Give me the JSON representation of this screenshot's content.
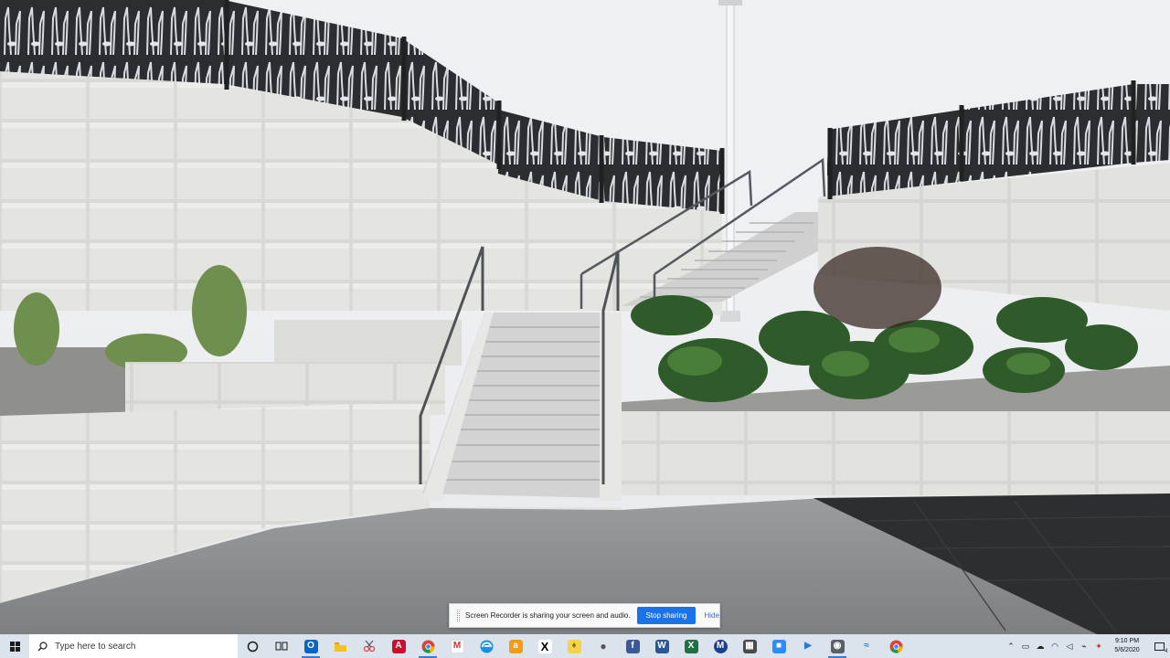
{
  "share_banner": {
    "message": "Screen Recorder is sharing your screen and audio.",
    "stop_label": "Stop sharing",
    "hide_label": "Hide"
  },
  "taskbar": {
    "search_placeholder": "Type here to search",
    "apps": [
      {
        "icon": "cortana-icon",
        "active": false
      },
      {
        "icon": "task-view-icon",
        "active": false
      },
      {
        "icon": "outlook-icon",
        "active": true
      },
      {
        "icon": "file-explorer-icon",
        "active": false
      },
      {
        "icon": "snipping-tool-icon",
        "active": false
      },
      {
        "icon": "acrobat-icon",
        "active": false
      },
      {
        "icon": "chrome-icon",
        "active": true
      },
      {
        "icon": "gmail-icon",
        "active": false
      },
      {
        "icon": "edge-icon",
        "active": false
      },
      {
        "icon": "amazon-icon",
        "active": false
      },
      {
        "icon": "x-icon",
        "active": false
      },
      {
        "icon": "sticky-notes-icon",
        "active": false
      },
      {
        "icon": "apple-icon",
        "active": false
      },
      {
        "icon": "facebook-icon",
        "active": false
      },
      {
        "icon": "word-icon",
        "active": false
      },
      {
        "icon": "excel-icon",
        "active": false
      },
      {
        "icon": "malwarebytes-icon",
        "active": false
      },
      {
        "icon": "calculator-icon",
        "active": false
      },
      {
        "icon": "zoom-icon",
        "active": false
      },
      {
        "icon": "app-icon",
        "active": false
      },
      {
        "icon": "screen-recorder-icon",
        "active": true
      },
      {
        "icon": "app-icon",
        "active": false
      },
      {
        "icon": "chrome-icon",
        "active": false
      }
    ],
    "clock_time": "9:10 PM",
    "clock_date": "5/6/2020",
    "notification_count": "4"
  },
  "colors": {
    "taskbar_bg": "#dbe3ec",
    "accent": "#1a73e8"
  }
}
